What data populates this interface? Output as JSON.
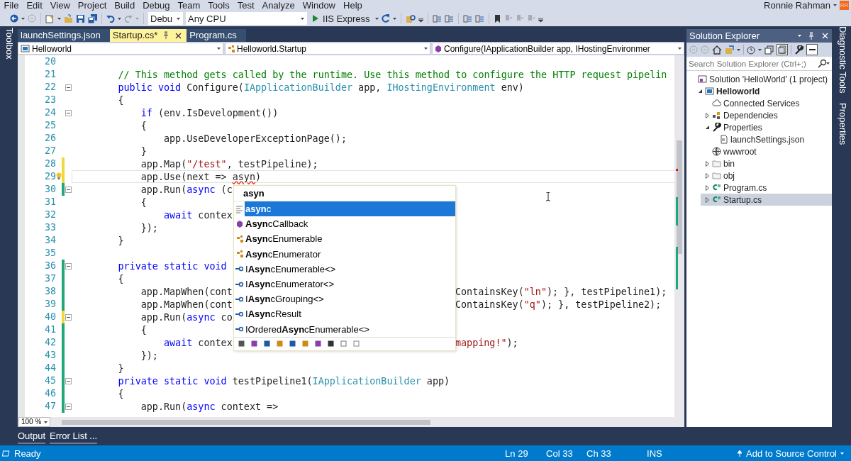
{
  "menu": [
    "File",
    "Edit",
    "View",
    "Project",
    "Build",
    "Debug",
    "Team",
    "Tools",
    "Test",
    "Analyze",
    "Window",
    "Help"
  ],
  "account": {
    "user": "Ronnie Rahman",
    "initials": "RR"
  },
  "toolbar": {
    "configuration": "Debu",
    "platform": "Any CPU",
    "start": "IIS Express"
  },
  "left_strip": {
    "label": "Toolbox"
  },
  "tabs": [
    {
      "label": "launchSettings.json",
      "selected": false
    },
    {
      "label": "Startup.cs*",
      "selected": true
    },
    {
      "label": "Program.cs",
      "selected": false
    }
  ],
  "navigation": {
    "project": "Helloworld",
    "type": "Helloworld.Startup",
    "member": "Configure(IApplicationBuilder app, IHostingEnvironmer"
  },
  "code_lines": [
    {
      "number": "20",
      "changed": false,
      "foldable": false,
      "current": false
    },
    {
      "number": "21",
      "changed": false,
      "foldable": false,
      "current": false,
      "tokens": [
        {
          "kind": "comment",
          "text": "        // This method gets called by the runtime. Use this method to configure the HTTP request pipelin"
        }
      ]
    },
    {
      "number": "22",
      "changed": false,
      "foldable": true,
      "current": false,
      "tokens": [
        {
          "kind": "keyword",
          "text": "        public void"
        },
        {
          "kind": "plain",
          "text": " Configure("
        },
        {
          "kind": "type",
          "text": "IApplicationBuilder"
        },
        {
          "kind": "plain",
          "text": " app, "
        },
        {
          "kind": "type",
          "text": "IHostingEnvironment"
        },
        {
          "kind": "plain",
          "text": " env)"
        }
      ]
    },
    {
      "number": "23",
      "changed": false,
      "foldable": false,
      "current": false,
      "tokens": [
        {
          "kind": "plain",
          "text": "        {"
        }
      ]
    },
    {
      "number": "24",
      "changed": false,
      "foldable": true,
      "current": false,
      "tokens": [
        {
          "kind": "keyword",
          "text": "            if"
        },
        {
          "kind": "plain",
          "text": " (env.IsDevelopment())"
        }
      ]
    },
    {
      "number": "25",
      "changed": false,
      "foldable": false,
      "current": false,
      "tokens": [
        {
          "kind": "plain",
          "text": "            {"
        }
      ]
    },
    {
      "number": "26",
      "changed": false,
      "foldable": false,
      "current": false,
      "tokens": [
        {
          "kind": "plain",
          "text": "                app.UseDeveloperExceptionPage();"
        }
      ]
    },
    {
      "number": "27",
      "changed": false,
      "foldable": false,
      "current": false,
      "tokens": [
        {
          "kind": "plain",
          "text": "            }"
        }
      ]
    },
    {
      "number": "28",
      "changed": true,
      "saved": false,
      "foldable": false,
      "current": false,
      "tokens": [
        {
          "kind": "plain",
          "text": "            app.Map("
        },
        {
          "kind": "string",
          "text": "\"/test\""
        },
        {
          "kind": "plain",
          "text": ", testPipeline);"
        }
      ]
    },
    {
      "number": "29",
      "changed": true,
      "saved": false,
      "foldable": false,
      "current": true,
      "lightbulb": true,
      "tokens": [
        {
          "kind": "plain",
          "text": "            app.Use(next => "
        },
        {
          "kind": "error",
          "text": "asyn"
        },
        {
          "kind": "plain",
          "text": ")"
        }
      ]
    },
    {
      "number": "30",
      "changed": true,
      "saved": true,
      "foldable": true,
      "current": false,
      "tokens": [
        {
          "kind": "plain",
          "text": "            app.Run("
        },
        {
          "kind": "keyword",
          "text": "async"
        },
        {
          "kind": "plain",
          "text": " (c"
        }
      ]
    },
    {
      "number": "31",
      "changed": false,
      "foldable": false,
      "current": false,
      "tokens": [
        {
          "kind": "plain",
          "text": "            {"
        }
      ]
    },
    {
      "number": "32",
      "changed": false,
      "foldable": false,
      "current": false,
      "tokens": [
        {
          "kind": "keyword",
          "text": "                await"
        },
        {
          "kind": "plain",
          "text": " contex"
        }
      ]
    },
    {
      "number": "33",
      "changed": false,
      "foldable": false,
      "current": false,
      "tokens": [
        {
          "kind": "plain",
          "text": "            });"
        }
      ]
    },
    {
      "number": "34",
      "changed": false,
      "foldable": false,
      "current": false,
      "tokens": [
        {
          "kind": "plain",
          "text": "        }"
        }
      ]
    },
    {
      "number": "35",
      "changed": false,
      "foldable": false,
      "current": false
    },
    {
      "number": "36",
      "changed": true,
      "saved": true,
      "foldable": true,
      "current": false,
      "tokens": [
        {
          "kind": "keyword",
          "text": "        private static void"
        }
      ]
    },
    {
      "number": "37",
      "changed": true,
      "saved": true,
      "foldable": false,
      "current": false,
      "tokens": [
        {
          "kind": "plain",
          "text": "        {"
        }
      ]
    },
    {
      "number": "38",
      "changed": true,
      "saved": true,
      "foldable": false,
      "current": false,
      "tokens": [
        {
          "kind": "plain",
          "text": "            app.MapWhen(cont"
        }
      ],
      "tail": [
        {
          "kind": "plain",
          "text": "ContainsKey("
        },
        {
          "kind": "string",
          "text": "\"ln\""
        },
        {
          "kind": "plain",
          "text": "); }, testPipeline1);"
        }
      ]
    },
    {
      "number": "39",
      "changed": true,
      "saved": true,
      "foldable": false,
      "current": false,
      "tokens": [
        {
          "kind": "plain",
          "text": "            app.MapWhen(cont"
        }
      ],
      "tail": [
        {
          "kind": "plain",
          "text": "ContainsKey("
        },
        {
          "kind": "string",
          "text": "\"q\""
        },
        {
          "kind": "plain",
          "text": "); }, testPipeline2);"
        }
      ]
    },
    {
      "number": "40",
      "changed": true,
      "saved": false,
      "foldable": true,
      "current": false,
      "tokens": [
        {
          "kind": "plain",
          "text": "            app.Run("
        },
        {
          "kind": "keyword",
          "text": "async"
        },
        {
          "kind": "plain",
          "text": " co"
        }
      ]
    },
    {
      "number": "41",
      "changed": true,
      "saved": true,
      "foldable": false,
      "current": false,
      "tokens": [
        {
          "kind": "plain",
          "text": "            {"
        }
      ]
    },
    {
      "number": "42",
      "changed": true,
      "saved": true,
      "foldable": false,
      "current": false,
      "tokens": [
        {
          "kind": "keyword",
          "text": "                await"
        },
        {
          "kind": "plain",
          "text": " contex"
        }
      ],
      "tail": [
        {
          "kind": "string",
          "text": "mapping!\""
        },
        {
          "kind": "plain",
          "text": ");"
        }
      ]
    },
    {
      "number": "43",
      "changed": true,
      "saved": true,
      "foldable": false,
      "current": false,
      "tokens": [
        {
          "kind": "plain",
          "text": "            });"
        }
      ]
    },
    {
      "number": "44",
      "changed": true,
      "saved": true,
      "foldable": false,
      "current": false,
      "tokens": [
        {
          "kind": "plain",
          "text": "        }"
        }
      ]
    },
    {
      "number": "45",
      "changed": true,
      "saved": true,
      "foldable": true,
      "current": false,
      "tokens": [
        {
          "kind": "keyword",
          "text": "        private static void"
        },
        {
          "kind": "plain",
          "text": " testPipeline1("
        },
        {
          "kind": "type",
          "text": "IApplicationBuilder"
        },
        {
          "kind": "plain",
          "text": " app)"
        }
      ]
    },
    {
      "number": "46",
      "changed": true,
      "saved": true,
      "foldable": false,
      "current": false,
      "tokens": [
        {
          "kind": "plain",
          "text": "        {"
        }
      ]
    },
    {
      "number": "47",
      "changed": true,
      "saved": true,
      "foldable": true,
      "current": false,
      "tokens": [
        {
          "kind": "plain",
          "text": "            app.Run("
        },
        {
          "kind": "keyword",
          "text": "async"
        },
        {
          "kind": "plain",
          "text": " context =>"
        }
      ]
    }
  ],
  "completion": {
    "typed": "asyn",
    "items": [
      {
        "text": "**asyn**c",
        "kind": "keyword",
        "selected": true
      },
      {
        "text": "**Asyn**cCallback",
        "kind": "delegate",
        "selected": false
      },
      {
        "text": "**Asyn**cEnumerable",
        "kind": "class",
        "selected": false
      },
      {
        "text": "**Asyn**cEnumerator",
        "kind": "class",
        "selected": false
      },
      {
        "text": "I**Asyn**cEnumerable<>",
        "kind": "interface",
        "selected": false
      },
      {
        "text": "I**Asyn**cEnumerator<>",
        "kind": "interface",
        "selected": false
      },
      {
        "text": "I**Asyn**cGrouping<>",
        "kind": "interface",
        "selected": false
      },
      {
        "text": "I**Asyn**cResult",
        "kind": "interface",
        "selected": false
      },
      {
        "text": "IOrdered**Asyn**cEnumerable<>",
        "kind": "interface",
        "selected": false
      }
    ]
  },
  "zoom": "100 %",
  "solution_explorer": {
    "title": "Solution Explorer",
    "search": {
      "placeholder": "Search Solution Explorer (Ctrl+;)"
    },
    "tree": [
      {
        "label": "Solution 'HelloWorld' (1 project)",
        "kind": "solution",
        "selected": false,
        "children": [
          {
            "label": "Helloworld",
            "kind": "project",
            "expanded": true,
            "selected": false,
            "children": [
              {
                "label": "Connected Services",
                "kind": "connected",
                "selected": false
              },
              {
                "label": "Dependencies",
                "kind": "dependencies",
                "expanded": false,
                "selected": false
              },
              {
                "label": "Properties",
                "kind": "properties",
                "expanded": true,
                "selected": false,
                "children": [
                  {
                    "label": "launchSettings.json",
                    "kind": "json",
                    "selected": false
                  }
                ]
              },
              {
                "label": "wwwroot",
                "kind": "web",
                "selected": false
              },
              {
                "label": "bin",
                "kind": "folder",
                "expanded": false,
                "selected": false
              },
              {
                "label": "obj",
                "kind": "folder",
                "expanded": false,
                "selected": false
              },
              {
                "label": "Program.cs",
                "kind": "csharp",
                "expanded": false,
                "selected": false
              },
              {
                "label": "Startup.cs",
                "kind": "csharp",
                "expanded": false,
                "selected": true
              }
            ]
          }
        ]
      }
    ]
  },
  "right_strip": [
    "Diagnostic Tools",
    "Properties"
  ],
  "bottom_tabs": [
    "Output",
    "Error List ..."
  ],
  "status_bar": {
    "message": "Ready",
    "line": "Ln 29",
    "column": "Col 33",
    "char": "Ch 33",
    "mode": "INS",
    "source_control": "Add to Source Control"
  }
}
